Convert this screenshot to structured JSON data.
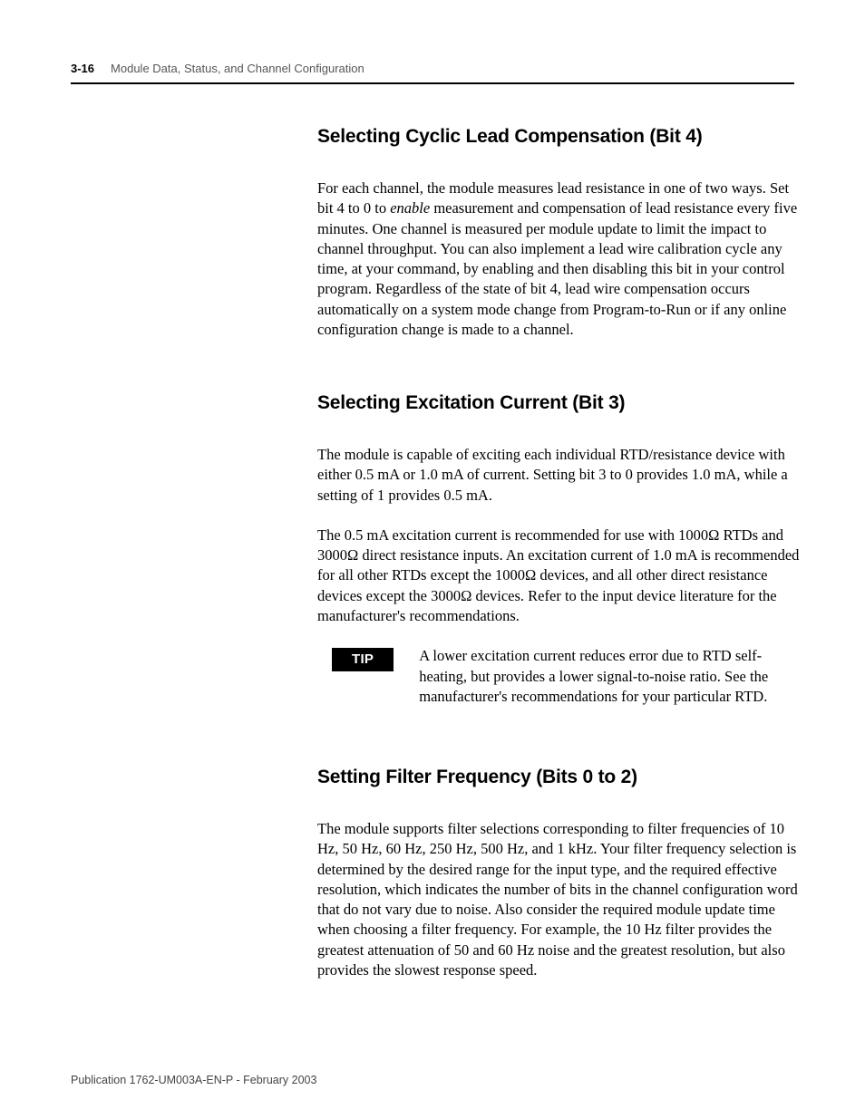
{
  "header": {
    "page_number": "3-16",
    "chapter_title": "Module Data, Status, and Channel Configuration"
  },
  "sections": [
    {
      "heading": "Selecting Cyclic Lead Compensation (Bit 4)",
      "paragraphs": [
        "For each channel, the module measures lead resistance in one of two ways. Set bit 4 to 0 to enable measurement and compensation of lead resistance every five minutes. One channel is measured per module update to limit the impact to channel throughput. You can also implement a lead wire calibration cycle any time, at your command, by enabling and then disabling this bit in your control program. Regardless of the state of bit 4, lead wire compensation occurs automatically on a system mode change from Program-to-Run or if any online configuration change is made to a channel."
      ]
    },
    {
      "heading": "Selecting Excitation Current (Bit 3)",
      "paragraphs": [
        "The module is capable of exciting each individual RTD/resistance device with either 0.5 mA or 1.0 mA of current. Setting bit 3 to 0 provides 1.0 mA, while a setting of 1 provides 0.5 mA.",
        "The 0.5 mA excitation current is recommended for use with 1000Ω RTDs and 3000Ω direct resistance inputs. An excitation current of 1.0 mA is recommended for all other RTDs except the 1000Ω devices, and all other direct resistance devices except the 3000Ω devices. Refer to the input device literature for the manufacturer's recommendations."
      ],
      "tip": {
        "label": "TIP",
        "text": "A lower excitation current reduces error due to RTD self-heating, but provides a lower signal-to-noise ratio. See the manufacturer's recommendations for your particular RTD."
      }
    },
    {
      "heading": "Setting Filter Frequency (Bits 0 to 2)",
      "paragraphs": [
        "The module supports filter selections corresponding to filter frequencies of 10 Hz, 50 Hz, 60 Hz, 250 Hz, 500 Hz, and 1 kHz. Your filter frequency selection is determined by the desired range for the input type, and the required effective resolution, which indicates the number of bits in the channel configuration word that do not vary due to noise. Also consider the required module update time when choosing a filter frequency. For example, the 10 Hz filter provides the greatest attenuation of 50 and 60 Hz noise and the greatest resolution, but also provides the slowest response speed."
      ]
    }
  ],
  "footer": {
    "publication": "Publication 1762-UM003A-EN-P - February 2003"
  }
}
